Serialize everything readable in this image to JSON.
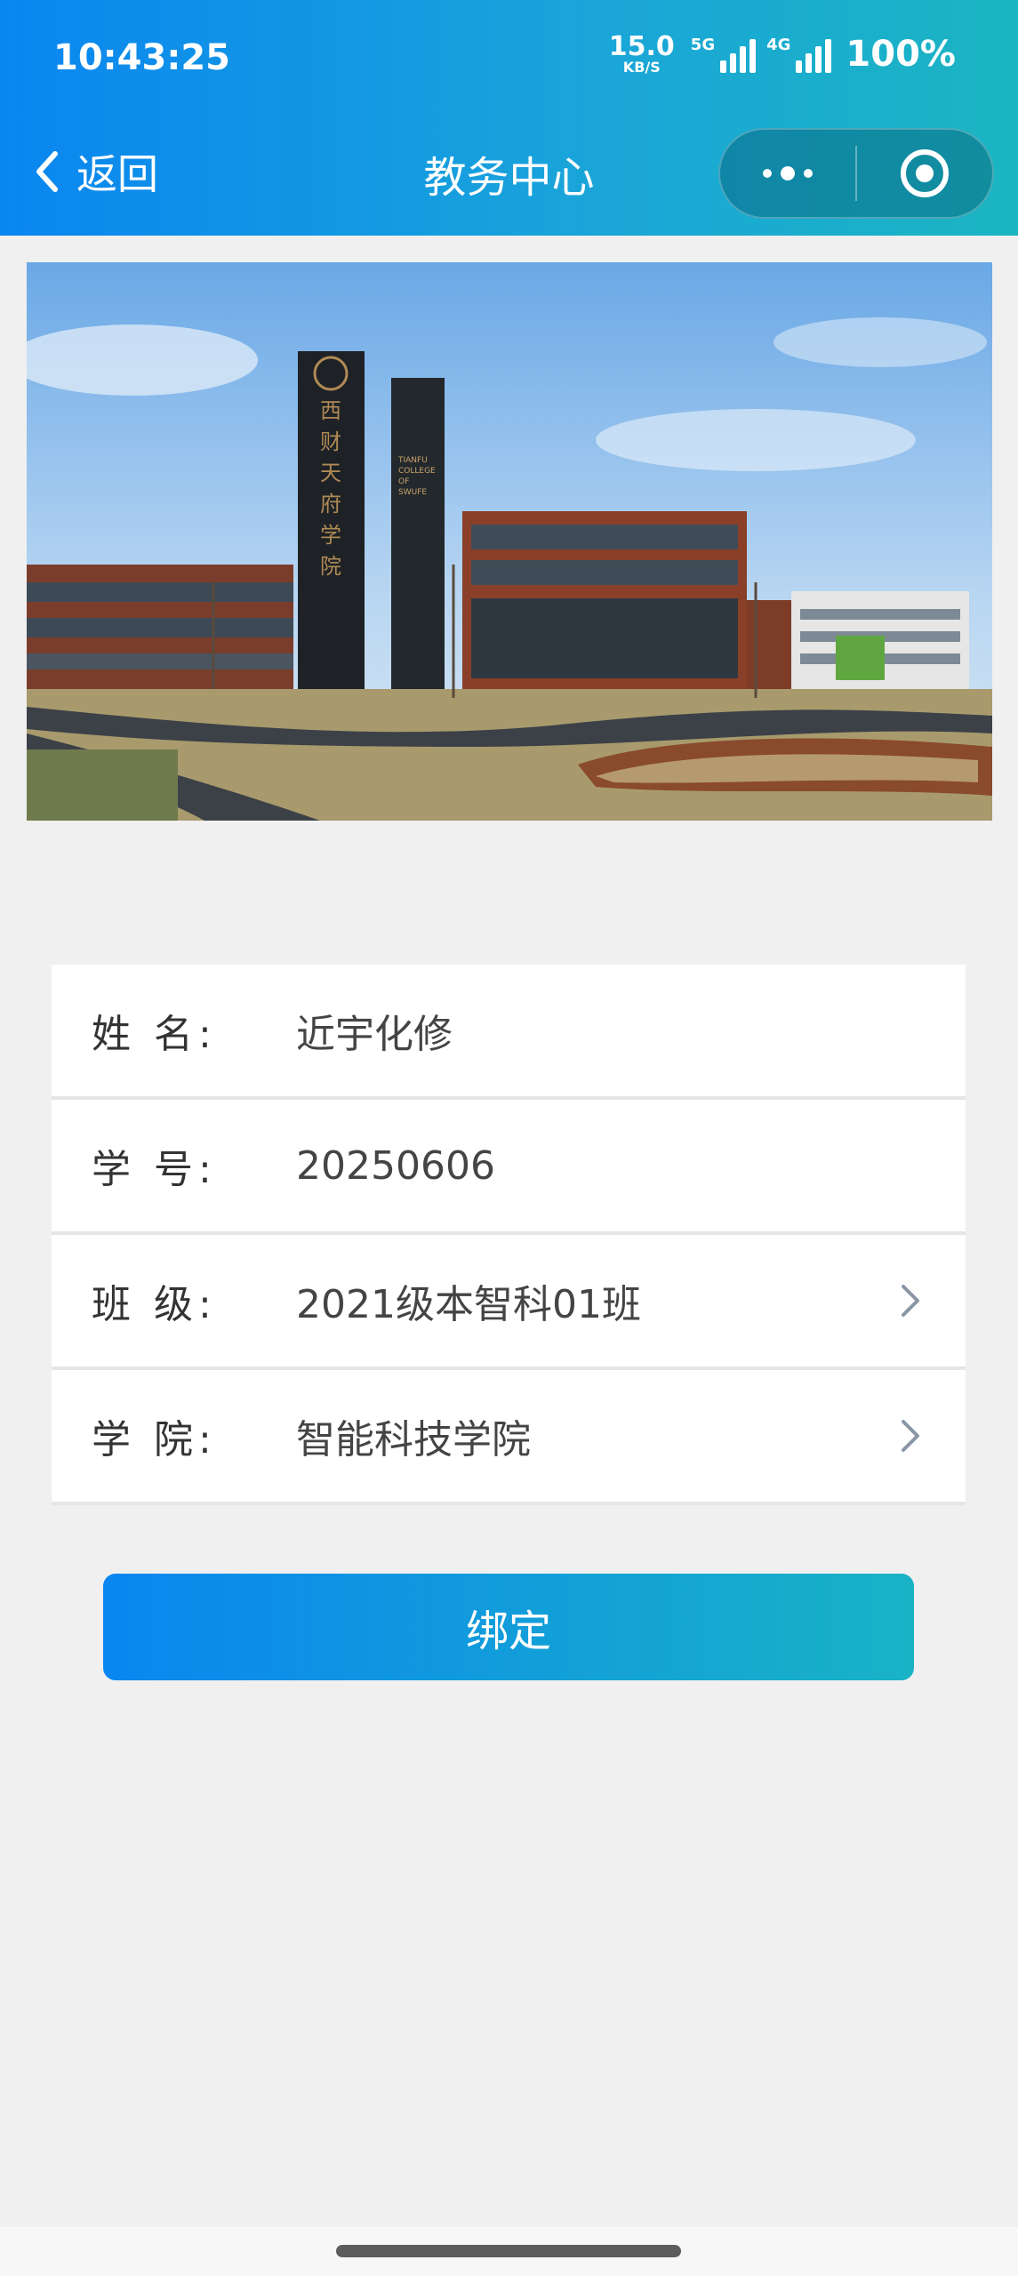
{
  "status_bar": {
    "time": "10:43:25",
    "net_speed": "15.0",
    "net_speed_unit": "KB/S",
    "network_1": "5G",
    "network_2": "4G",
    "battery": "100%"
  },
  "nav": {
    "back_label": "返回",
    "title": "教务中心",
    "more_icon": "more-dots-icon",
    "close_icon": "target-circle-icon"
  },
  "banner": {
    "sign_text": "西财天府学院",
    "sign_english": [
      "TIANFU",
      "COLLEGE",
      "OF",
      "SWUFE"
    ]
  },
  "form": {
    "rows": [
      {
        "label": "姓 名:",
        "value": "近宇化修",
        "has_arrow": false
      },
      {
        "label": "学 号:",
        "value": "20250606",
        "has_arrow": false
      },
      {
        "label": "班 级:",
        "value": "2021级本智科01班",
        "has_arrow": true
      },
      {
        "label": "学 院:",
        "value": "智能科技学院",
        "has_arrow": true
      }
    ]
  },
  "bind_button": {
    "label": "绑定"
  },
  "colors": {
    "gradient_start": "#0a86f0",
    "gradient_end": "#1bb5c2",
    "page_bg": "#f0f0f0"
  }
}
